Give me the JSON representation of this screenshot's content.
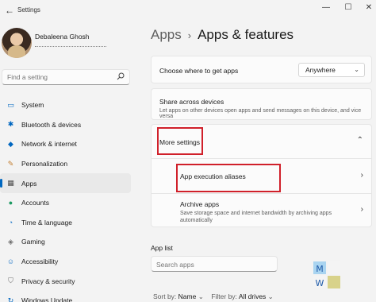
{
  "window": {
    "title": "Settings",
    "back_glyph": "←",
    "min": "—",
    "max": "☐",
    "close": "✕"
  },
  "profile": {
    "name": "Debaleena Ghosh"
  },
  "sidebar": {
    "search_placeholder": "Find a setting",
    "items": [
      {
        "label": "System",
        "icon": "monitor-icon",
        "glyph": "▭",
        "color": "#0067c0"
      },
      {
        "label": "Bluetooth & devices",
        "icon": "bluetooth-icon",
        "glyph": "✱",
        "color": "#0067c0"
      },
      {
        "label": "Network & internet",
        "icon": "wifi-icon",
        "glyph": "◆",
        "color": "#0067c0"
      },
      {
        "label": "Personalization",
        "icon": "brush-icon",
        "glyph": "✎",
        "color": "#c27c2c"
      },
      {
        "label": "Apps",
        "icon": "apps-icon",
        "glyph": "▦",
        "color": "#4a4a4a",
        "active": true
      },
      {
        "label": "Accounts",
        "icon": "person-icon",
        "glyph": "●",
        "color": "#1c9a62"
      },
      {
        "label": "Time & language",
        "icon": "globe-clock-icon",
        "glyph": "◔",
        "color": "#1a74c7"
      },
      {
        "label": "Gaming",
        "icon": "controller-icon",
        "glyph": "◈",
        "color": "#6b6b6b"
      },
      {
        "label": "Accessibility",
        "icon": "accessibility-icon",
        "glyph": "☺",
        "color": "#1a74c7"
      },
      {
        "label": "Privacy & security",
        "icon": "shield-icon",
        "glyph": "⛉",
        "color": "#6b6b6b"
      },
      {
        "label": "Windows Update",
        "icon": "update-icon",
        "glyph": "↻",
        "color": "#0067c0"
      }
    ]
  },
  "breadcrumb": {
    "parent": "Apps",
    "separator": "›",
    "current": "Apps & features"
  },
  "cards": {
    "where_to_get": {
      "label": "Choose where to get apps",
      "value": "Anywhere"
    },
    "share": {
      "label": "Share across devices",
      "desc": "Let apps on other devices open apps and send messages on this device, and vice versa"
    },
    "more_settings": {
      "label": "More settings"
    },
    "aliases": {
      "label": "App execution aliases"
    },
    "archive": {
      "label": "Archive apps",
      "desc": "Save storage space and internet bandwidth by archiving apps automatically"
    }
  },
  "app_list": {
    "title": "App list",
    "search_placeholder": "Search apps",
    "sort_label": "Sort by:",
    "sort_value": "Name",
    "filter_label": "Filter by:",
    "filter_value": "All drives"
  },
  "watermark": {
    "letters": [
      "M",
      "W"
    ]
  },
  "colors": {
    "accent": "#0067c0",
    "highlight": "#d0202a"
  }
}
